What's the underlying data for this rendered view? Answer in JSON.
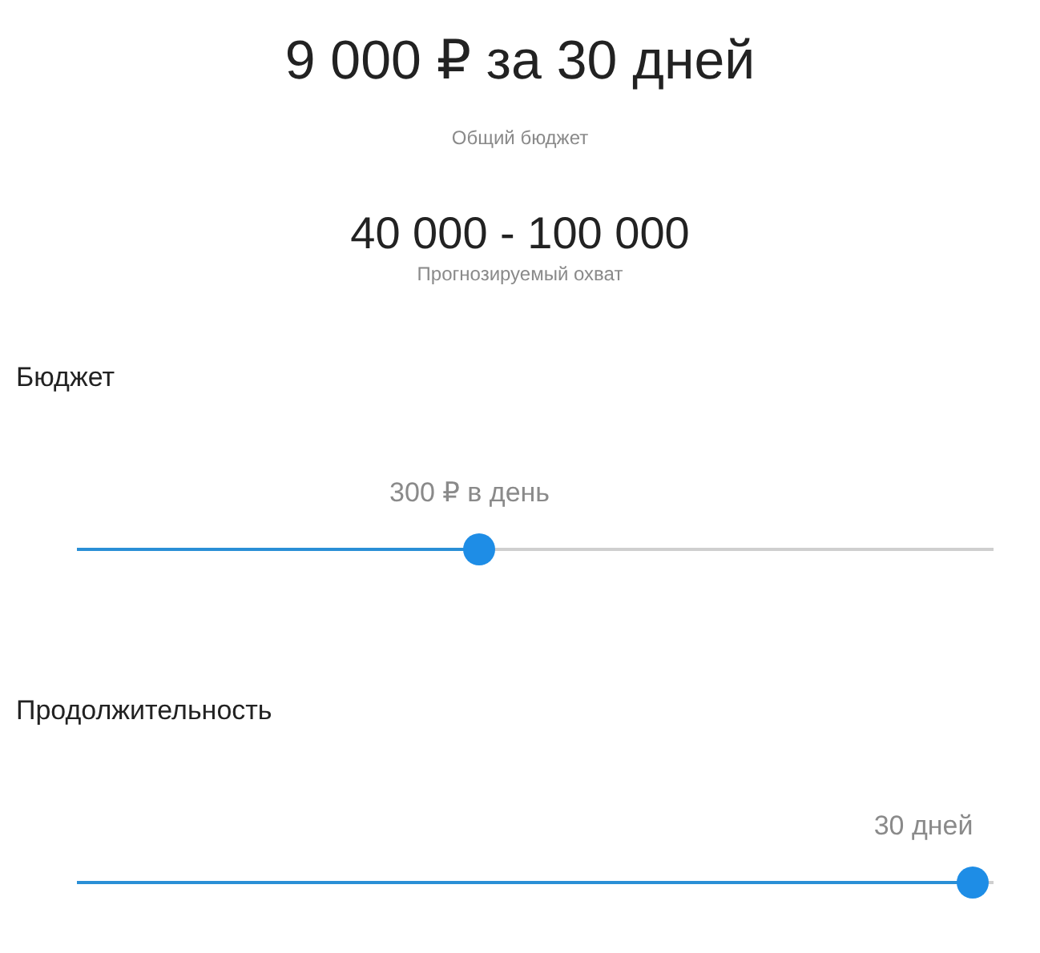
{
  "summary": {
    "total": "9 000 ₽ за 30 дней",
    "total_caption": "Общий бюджет",
    "reach": "40 000 - 100 000",
    "reach_caption": "Прогнозируемый охват"
  },
  "sliders": [
    {
      "title": "Бюджет",
      "reading": "300 ₽ в день",
      "level": 0.436
    },
    {
      "title": "Продолжительность",
      "reading": "30 дней",
      "level": 0.995
    }
  ]
}
